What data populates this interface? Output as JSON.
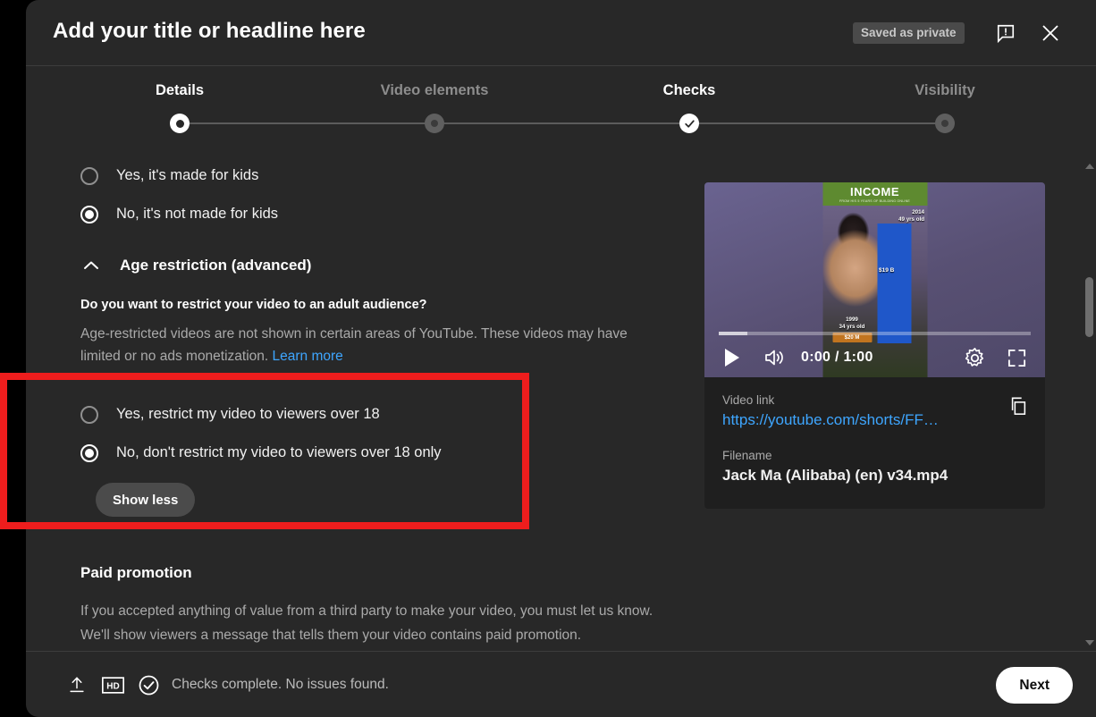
{
  "header": {
    "title": "Add your title or headline here",
    "saved_status": "Saved as private",
    "feedback_icon": "feedback-icon",
    "close_icon": "close-icon"
  },
  "stepper": {
    "steps": [
      {
        "label": "Details",
        "state": "current"
      },
      {
        "label": "Video elements",
        "state": "todo"
      },
      {
        "label": "Checks",
        "state": "done"
      },
      {
        "label": "Visibility",
        "state": "todo"
      }
    ]
  },
  "made_for_kids": {
    "options": [
      {
        "label": "Yes, it's made for kids",
        "selected": false
      },
      {
        "label": "No, it's not made for kids",
        "selected": true
      }
    ]
  },
  "age_restriction": {
    "section_title": "Age restriction (advanced)",
    "expand_icon": "chevron-up-icon",
    "question": "Do you want to restrict your video to an adult audience?",
    "description": "Age-restricted videos are not shown in certain areas of YouTube. These videos may have limited or no ads monetization.",
    "learn_more": "Learn more",
    "options": [
      {
        "label": "Yes, restrict my video to viewers over 18",
        "selected": false
      },
      {
        "label": "No, don't restrict my video to viewers over 18 only",
        "selected": true
      }
    ],
    "toggle_button": "Show less"
  },
  "paid_promotion": {
    "title": "Paid promotion",
    "line1": "If you accepted anything of value from a third party to make your video, you must let us know.",
    "line2": "We'll show viewers a message that tells them your video contains paid promotion."
  },
  "preview": {
    "player": {
      "play_icon": "play-icon",
      "volume_icon": "volume-icon",
      "time": "0:00 / 1:00",
      "settings_icon": "gear-icon",
      "fullscreen_icon": "fullscreen-icon"
    },
    "thumbnail": {
      "header_title": "INCOME",
      "header_subtitle": "FROM HIS 5 YEARS OF BUILDING ONLINE",
      "year_label": "2014",
      "age_label": "49 yrs old",
      "money_label": "$19 B",
      "low_year_label": "1999",
      "low_age_label": "34 yrs old",
      "low_chip_label": "$20 M"
    },
    "video_link_label": "Video link",
    "video_link": "https://youtube.com/shorts/FF…",
    "copy_icon": "copy-icon",
    "filename_label": "Filename",
    "filename": "Jack Ma (Alibaba) (en) v34.mp4"
  },
  "footer": {
    "upload_icon": "upload-icon",
    "hd_icon": "hd-badge-icon",
    "check_icon": "check-circle-icon",
    "status": "Checks complete. No issues found.",
    "next_label": "Next"
  },
  "colors": {
    "dialog_bg": "#282828",
    "card_bg": "#1f1f1f",
    "accent_link": "#3ea6ff",
    "highlight": "#ee1d1d",
    "text_primary": "#f1f1f1",
    "text_secondary": "#aaaaaa"
  }
}
